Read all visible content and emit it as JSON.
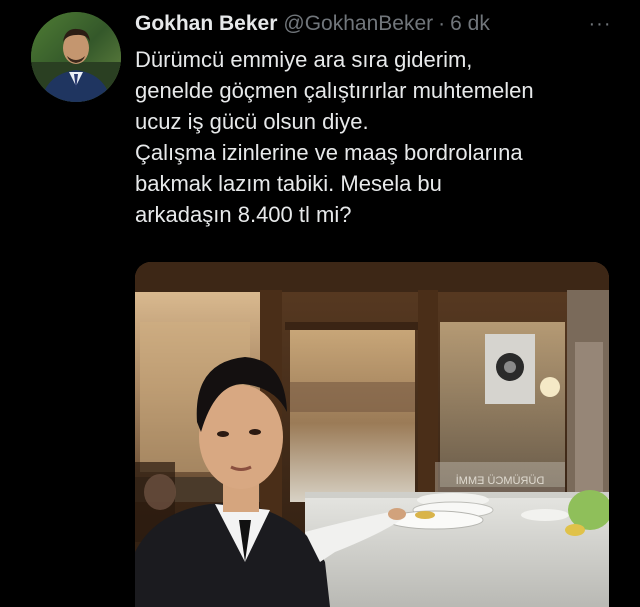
{
  "tweet": {
    "author_name": "Gokhan Beker",
    "author_handle": "@GokhanBeker",
    "separator": "·",
    "timestamp": "6 dk",
    "more_icon": "more-horizontal-icon",
    "more_label": "···",
    "text_lines": [
      "Dürümcü emmiye ara sıra giderim,",
      "genelde göçmen çalıştırırlar muhtemelen",
      "ucuz iş gücü olsun diye.",
      "Çalışma izinlerine ve maaş bordrolarına",
      "bakmak lazım tabiki. Mesela bu",
      "arkadaşın 8.400 tl mi?"
    ],
    "media": {
      "kind": "photo",
      "window_sign_text": "DÜRÜMCÜ EMMİ"
    }
  },
  "colors": {
    "background": "#000000",
    "primary_text": "#e7e9ea",
    "secondary_text": "#71767b"
  }
}
